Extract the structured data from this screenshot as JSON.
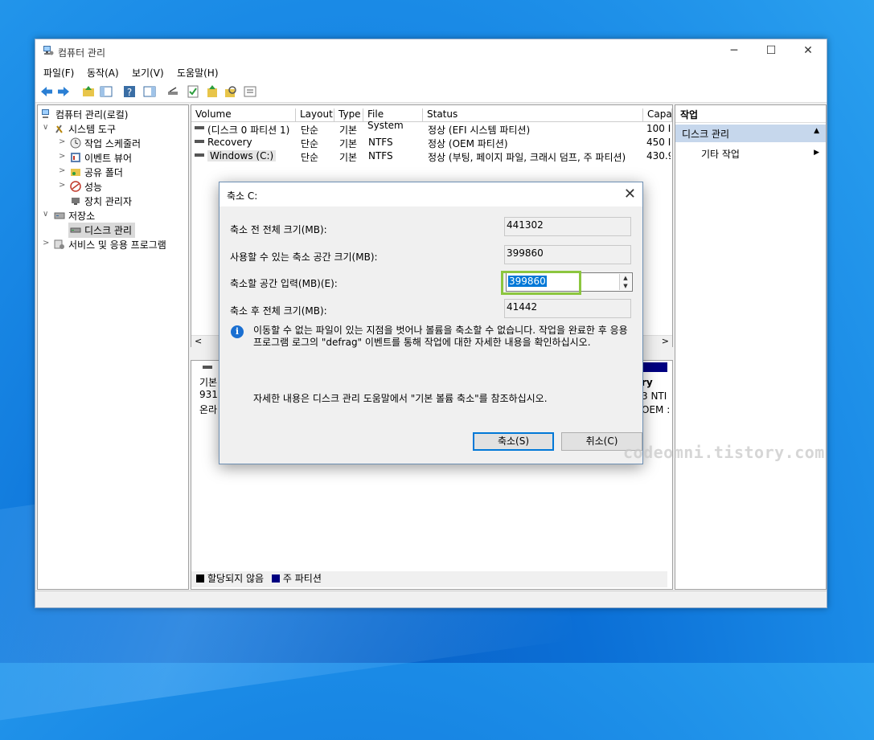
{
  "window": {
    "title": "컴퓨터 관리",
    "controls": [
      "─",
      "☐",
      "✕"
    ]
  },
  "menu": [
    "파일(F)",
    "동작(A)",
    "보기(V)",
    "도움말(H)"
  ],
  "tree": {
    "root": "컴퓨터 관리(로컬)",
    "system_tools": "시스템 도구",
    "task_scheduler": "작업 스케줄러",
    "event_viewer": "이벤트 뷰어",
    "shared_folders": "공유 폴더",
    "performance": "성능",
    "device_manager": "장치 관리자",
    "storage": "저장소",
    "disk_management": "디스크 관리",
    "services": "서비스 및 응용 프로그램"
  },
  "volumes": {
    "columns": [
      "Volume",
      "Layout",
      "Type",
      "File System",
      "Status",
      "Capa"
    ],
    "rows": [
      {
        "volume": "(디스크 0 파티션 1)",
        "layout": "단순",
        "type": "기본",
        "fs": "",
        "status": "정상 (EFI 시스템 파티션)",
        "cap": "100 I"
      },
      {
        "volume": "Recovery",
        "layout": "단순",
        "type": "기본",
        "fs": "NTFS",
        "status": "정상 (OEM 파티션)",
        "cap": "450 I"
      },
      {
        "volume": "Windows (C:)",
        "layout": "단순",
        "type": "기본",
        "fs": "NTFS",
        "status": "정상 (부팅, 페이지 파일, 크래시 덤프, 주 파티션)",
        "cap": "430.9"
      }
    ]
  },
  "disk_pane": {
    "line1": "기본",
    "line2": "931.",
    "line3": "온라",
    "right1": "ry",
    "right2": "3 NTI",
    "right3": "OEM :"
  },
  "legend": {
    "unallocated": "할당되지 않음",
    "primary": "주 파티션",
    "unallocated_color": "#000000",
    "primary_color": "#000080"
  },
  "actions": {
    "header": "작업",
    "selected": "디스크 관리",
    "sub": "기타 작업"
  },
  "dialog": {
    "title": "축소 C:",
    "total_before_label": "축소 전 전체 크기(MB):",
    "total_before_value": "441302",
    "available_label": "사용할 수 있는 축소 공간 크기(MB):",
    "available_value": "399860",
    "enter_label": "축소할 공간 입력(MB)(E):",
    "enter_value": "399860",
    "total_after_label": "축소 후 전체 크기(MB):",
    "total_after_value": "41442",
    "info_text": "이동할 수 없는 파일이 있는 지점을 벗어나 볼륨을 축소할 수 없습니다. 작업을 완료한 후 응용 프로그램 로그의 \"defrag\" 이벤트를 통해 작업에 대한 자세한 내용을 확인하십시오.",
    "help_text": "자세한 내용은 디스크 관리 도움말에서 \"기본 볼륨 축소\"를 참조하십시오.",
    "shrink_button": "축소(S)",
    "cancel_button": "취소(C)",
    "highlight_color": "#8cc63f"
  },
  "watermark": "codeomni.tistory.com"
}
